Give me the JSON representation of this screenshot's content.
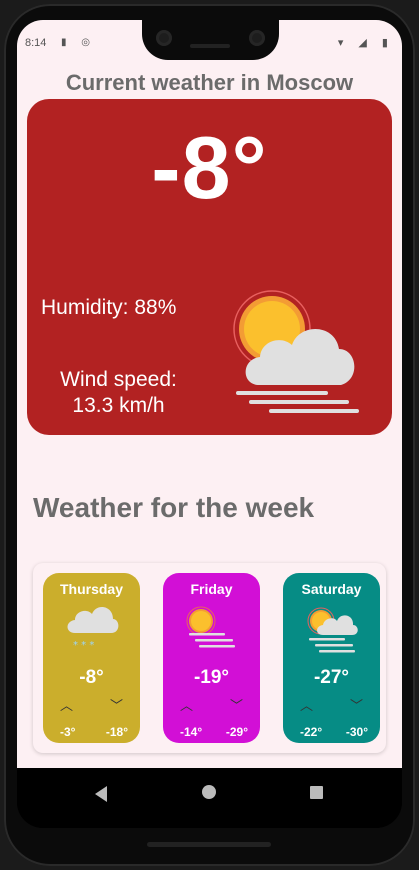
{
  "status": {
    "time": "8:14",
    "left_icons": "▮ ◎",
    "right_icons": "▾ ◢ ▮"
  },
  "app": {
    "title": "Current weather in Moscow",
    "current": {
      "temperature": "-8°",
      "humidity": "Humidity: 88%",
      "wind_label": "Wind speed:",
      "wind_value": "13.3 km/h",
      "icon": "sun-cloud-fog-icon",
      "card_color": "#b22222"
    },
    "week_title": "Weather for the week",
    "forecast": [
      {
        "day": "Thursday",
        "temp": "-8°",
        "low": "-3°",
        "high": "-18°",
        "icon": "snow-cloud-icon",
        "color": "#cbae2c"
      },
      {
        "day": "Friday",
        "temp": "-19°",
        "low": "-14°",
        "high": "-29°",
        "icon": "sun-fog-icon",
        "color": "#d20fd6"
      },
      {
        "day": "Saturday",
        "temp": "-27°",
        "low": "-22°",
        "high": "-30°",
        "icon": "sun-cloud-fog-icon",
        "color": "#068c85"
      }
    ]
  },
  "nav": {
    "back": "back",
    "home": "home",
    "recents": "recents"
  }
}
